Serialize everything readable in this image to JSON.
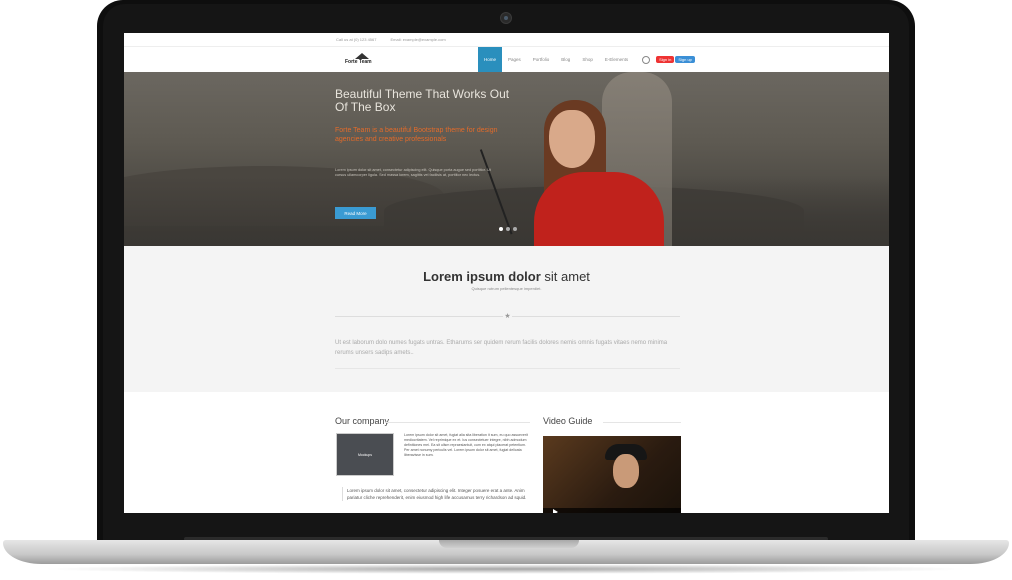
{
  "site": {
    "topbar": {
      "phone": "Call us at (0) 123 4567",
      "email": "Email: example@example.com"
    },
    "logo_text": "Forte Team",
    "nav": {
      "items": [
        "Home",
        "Pages",
        "Portfolio",
        "Blog",
        "Shop",
        "E-Elements"
      ],
      "active_index": 0,
      "signin_label": "Sign in",
      "signup_label": "Sign up"
    },
    "hero": {
      "title": "Beautiful Theme That Works Out Of The Box",
      "subtitle": "Forte Team is a beautiful Bootstrap theme for design agencies and creative professionals",
      "body": "Lorem ipsum dolor sit amet, consectetur adipiscing elit. Quisque porta augue sed porttitor. Ut cursus ullamcorper ligula. Sed massa lorem, sagittis vel facilisis at, porttitor nec lectus.",
      "button_label": "Read More",
      "slides": 3,
      "active_slide": 0
    },
    "intro": {
      "title_bold": "Lorem ipsum dolor",
      "title_rest": " sit amet",
      "subtitle": "Quisque rutrum pellentesque imperdiet.",
      "divider_icon": "star-icon",
      "text": "Ut est laborum dolo numes fugats untras. Etharums ser quidem rerum facilis dolores nemis omnis fugats vitaes nemo minima rerums unsers sadips amets.."
    },
    "company": {
      "title": "Our company",
      "thumb_label": "Mockups",
      "text": "Lorem ipsum dolor sit amet, fugiat alia sita liberation it sum, eu quo assueverit mediocritatem. Vel reprimique ex et. Ius consectetuer integre, nibh admodum definitiones mei. Ea sit ullsm repraesiantuit, cum ex atqui placerat petentium. Per amet nonumy periculis vel. Lorem ipsum dolor sit amet, fugiat delicata liberavisse in sum.",
      "text2": "Lorem ipsum dolor sit amet, consectetur adipiscing elit. Integer posuere erat a ante. Anim pariatur cliche reprehenderit, enim eiusmod high life accusamus terry richardson ad squid."
    },
    "video": {
      "title": "Video Guide"
    }
  }
}
